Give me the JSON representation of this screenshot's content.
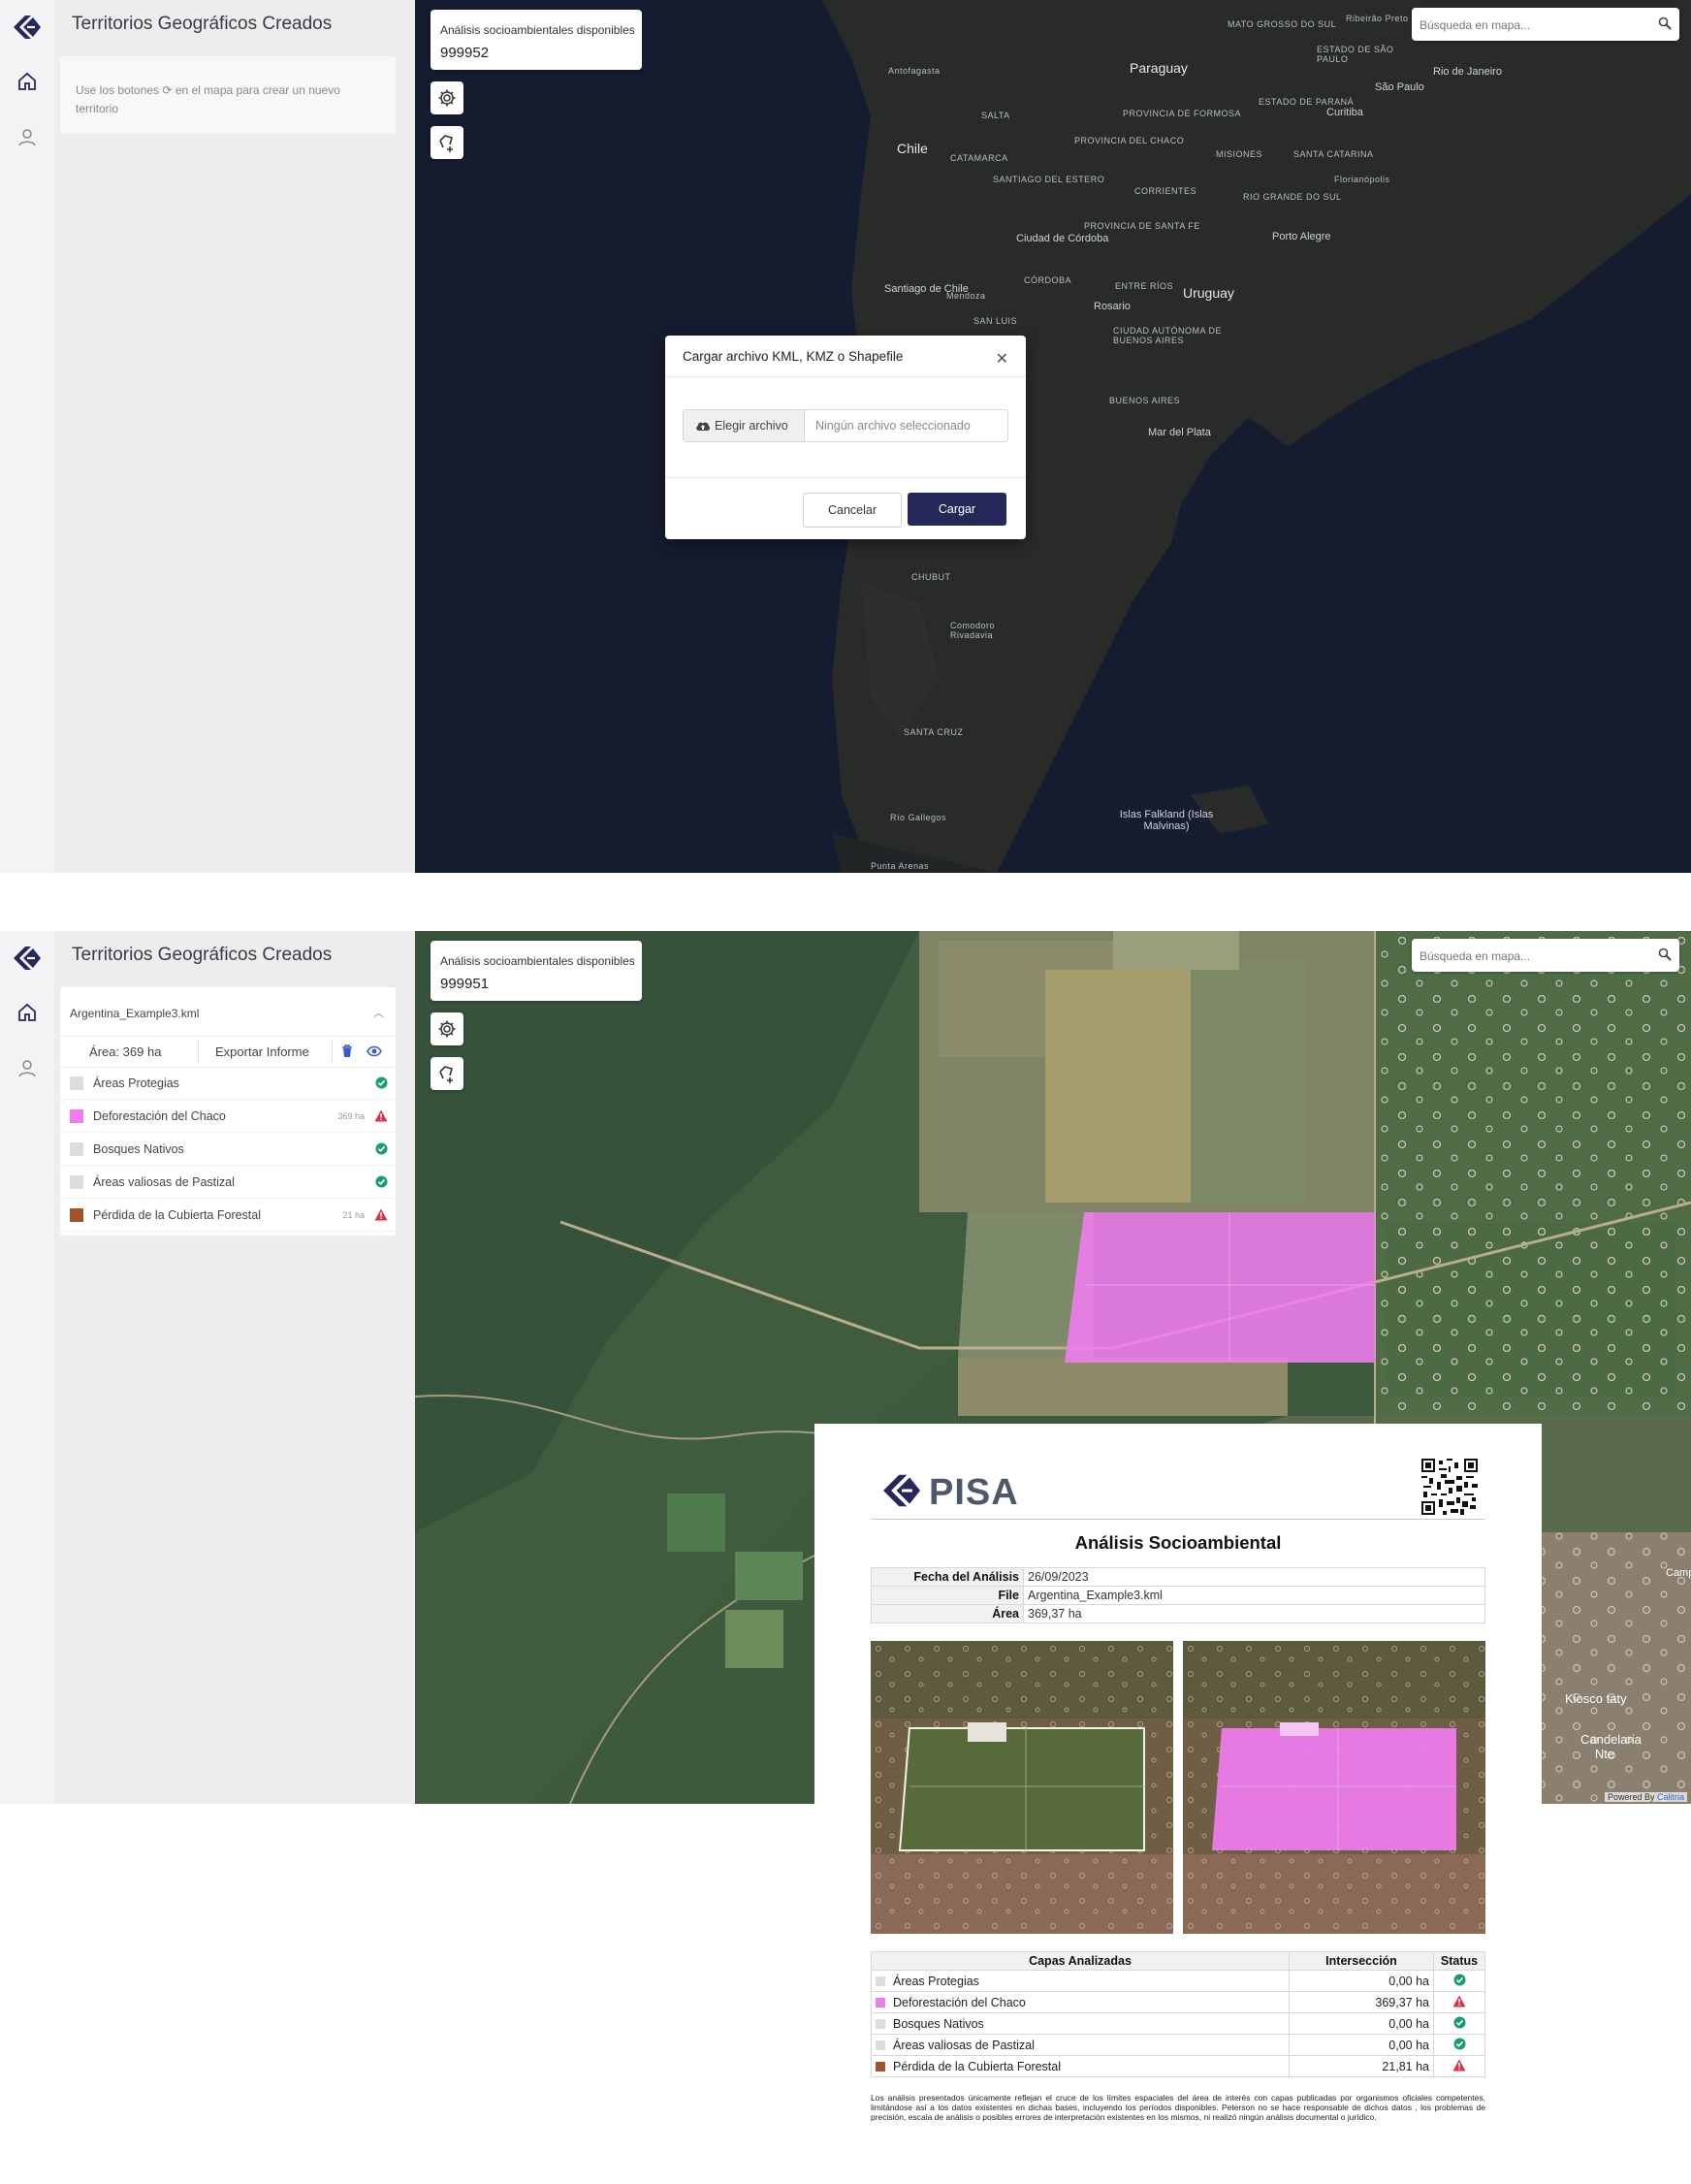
{
  "colors": {
    "brand_navy": "#27285a",
    "pink_layer": "#f07df0",
    "brown_layer": "#a2532b",
    "grey_layer": "#dcdcdf",
    "ok_green": "#1a9e6f",
    "warn_red": "#d9304b"
  },
  "screen1": {
    "panel_title": "Territorios Geográficos Creados",
    "hint_prefix": "Use los botones",
    "hint_suffix": "en el mapa para crear un nuevo territorio",
    "available_label": "Análisis socioambientales disponibles",
    "available_value": "999952",
    "search_placeholder": "Búsqueda en mapa...",
    "map_labels": [
      "Paraguay",
      "Chile",
      "Uruguay",
      "Porto Alegre",
      "São Paulo",
      "Rio de Janeiro",
      "Curitiba",
      "Ciudad de Córdoba",
      "Rosario",
      "Santiago de Chile",
      "MATO GROSSO DO SUL",
      "ESTADO DE PARANÁ",
      "PROVINCIA DE FORMOSA",
      "PROVINCIA DEL CHACO",
      "MISIONES",
      "SANTA CATARINA",
      "RIO GRANDE DO SUL",
      "CORRIENTES",
      "PROVINCIA DE SANTA FE",
      "ENTRE RÍOS",
      "CIUDAD AUTÓNOMA DE BUENOS AIRES",
      "BUENOS AIRES",
      "Mar del Plata",
      "Islas Falkland (Islas Malvinas)",
      "SANTA CRUZ",
      "CHUBUT",
      "SALTA",
      "CATAMARCA",
      "SANTIAGO DEL ESTERO",
      "CÓRDOBA",
      "SAN LUIS",
      "Mendoza",
      "Antofagasta",
      "Comodoro Rivadavia",
      "Río Gallegos",
      "ESTADO DE SÃO PAULO",
      "Florianópolis",
      "Ribeirão Preto",
      "Punta Arenas"
    ],
    "modal": {
      "title": "Cargar archivo KML, KMZ o Shapefile",
      "choose_file": "Elegir archivo",
      "no_file": "Ningún archivo seleccionado",
      "cancel": "Cancelar",
      "load": "Cargar"
    }
  },
  "screen2": {
    "panel_title": "Territorios Geográficos Creados",
    "available_label": "Análisis socioambientales disponibles",
    "available_value": "999951",
    "search_placeholder": "Búsqueda en mapa...",
    "territory": {
      "file_name": "Argentina_Example3.kml",
      "area_label": "Área: 369 ha",
      "export_label": "Exportar Informe",
      "layers": [
        {
          "name": "Áreas Protegias",
          "ha": "",
          "status": "ok",
          "color": "#dcdcdf"
        },
        {
          "name": "Deforestación del Chaco",
          "ha": "369 ha",
          "status": "warn",
          "color": "#f07df0"
        },
        {
          "name": "Bosques Nativos",
          "ha": "",
          "status": "ok",
          "color": "#dcdcdf"
        },
        {
          "name": "Áreas valiosas de Pastizal",
          "ha": "",
          "status": "ok",
          "color": "#dcdcdf"
        },
        {
          "name": "Pérdida de la Cubierta Forestal",
          "ha": "21 ha",
          "status": "warn",
          "color": "#a2532b"
        }
      ]
    },
    "map_labels": {
      "kiosco": "Kiosco taty",
      "candelaria": "Candelaria Nte",
      "camp": "Camp"
    },
    "powered_prefix": "Powered By",
    "powered_brand": "Calitria"
  },
  "report": {
    "logo_text": "PISA",
    "title": "Análisis Socioambiental",
    "meta": [
      {
        "key": "Fecha del Análisis",
        "value": "26/09/2023"
      },
      {
        "key": "File",
        "value": "Argentina_Example3.kml"
      },
      {
        "key": "Área",
        "value": "369,37 ha"
      }
    ],
    "table_headers": {
      "layers": "Capas Analizadas",
      "intersection": "Intersección",
      "status": "Status"
    },
    "rows": [
      {
        "name": "Áreas Protegias",
        "value": "0,00 ha",
        "status": "ok",
        "color": "#dcdcdf"
      },
      {
        "name": "Deforestación del Chaco",
        "value": "369,37 ha",
        "status": "warn",
        "color": "#f07df0"
      },
      {
        "name": "Bosques Nativos",
        "value": "0,00 ha",
        "status": "ok",
        "color": "#dcdcdf"
      },
      {
        "name": "Áreas valiosas de Pastizal",
        "value": "0,00 ha",
        "status": "ok",
        "color": "#dcdcdf"
      },
      {
        "name": "Pérdida de la Cubierta Forestal",
        "value": "21,81 ha",
        "status": "warn",
        "color": "#a2532b"
      }
    ],
    "disclaimer": "Los análisis presentados únicamente reflejan el cruce de los límites espaciales del área de interés con capas publicadas por organismos oficiales competentes, limitándose así a los datos existentes en dichas bases, incluyendo los períodos disponibles. Peterson no se hace responsable de dichos datos , los problemas de precisión, escala de análisis o posibles errores de interpretación existentes en los mismos, ni realizó ningún análisis documental o jurídico."
  }
}
